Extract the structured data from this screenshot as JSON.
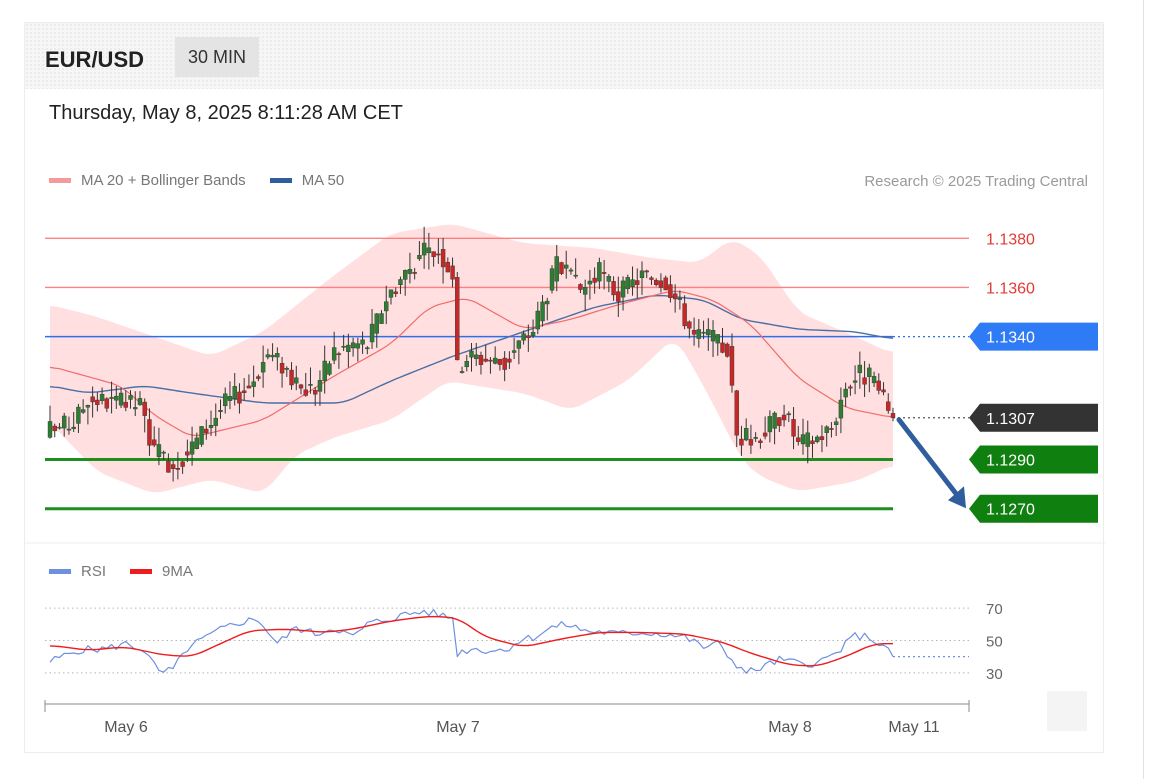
{
  "header": {
    "symbol": "EUR/USD",
    "interval": "30 MIN",
    "timestamp": "Thursday, May 8, 2025 8:11:28 AM CET"
  },
  "legend": {
    "ma20_label": "MA 20 + Bollinger Bands",
    "ma50_label": "MA 50",
    "copyright": "Research © 2025 Trading Central",
    "rsi_label": "RSI",
    "rsi_ma_label": "9MA"
  },
  "colors": {
    "bull": "#2e7d32",
    "bear": "#c62828",
    "ma20": "#f26b6b",
    "bands": "#ffd9d9",
    "ma50": "#4a6fa5",
    "resistance": "#ff8080",
    "pivot": "#2f6fec",
    "support": "#1e8e1e",
    "last": "#333333",
    "arrow": "#2f5d9e",
    "rsi": "#6f8fe0",
    "rsi_ma": "#ee1c1c"
  },
  "chart_data": [
    {
      "type": "candlestick",
      "title": "EUR/USD 30 MIN",
      "x_labels": [
        "May 6",
        "May 7",
        "May 8",
        "May 11"
      ],
      "ylim": [
        1.1265,
        1.1385
      ],
      "levels": [
        {
          "price": "1.1380",
          "value": 1.138,
          "role": "resistance"
        },
        {
          "price": "1.1360",
          "value": 1.136,
          "role": "resistance"
        },
        {
          "price": "1.1340",
          "value": 1.134,
          "role": "pivot"
        },
        {
          "price": "1.1307",
          "value": 1.1307,
          "role": "last"
        },
        {
          "price": "1.1290",
          "value": 1.129,
          "role": "support"
        },
        {
          "price": "1.1270",
          "value": 1.127,
          "role": "support"
        }
      ],
      "close_anchors": [
        [
          0,
          1.1302
        ],
        [
          5,
          1.1305
        ],
        [
          8,
          1.1315
        ],
        [
          14,
          1.1313
        ],
        [
          19,
          1.1312
        ],
        [
          22,
          1.1293
        ],
        [
          26,
          1.1288
        ],
        [
          29,
          1.1293
        ],
        [
          33,
          1.1303
        ],
        [
          37,
          1.1313
        ],
        [
          42,
          1.132
        ],
        [
          46,
          1.1333
        ],
        [
          50,
          1.1327
        ],
        [
          52,
          1.1319
        ],
        [
          56,
          1.1319
        ],
        [
          60,
          1.1334
        ],
        [
          64,
          1.1337
        ],
        [
          67,
          1.1337
        ],
        [
          71,
          1.1356
        ],
        [
          75,
          1.1366
        ],
        [
          79,
          1.1374
        ],
        [
          82,
          1.1375
        ],
        [
          85,
          1.1366
        ],
        [
          86,
          1.1327
        ],
        [
          88,
          1.1332
        ],
        [
          92,
          1.1331
        ],
        [
          96,
          1.1329
        ],
        [
          99,
          1.1337
        ],
        [
          102,
          1.1343
        ],
        [
          107,
          1.1369
        ],
        [
          112,
          1.1359
        ],
        [
          116,
          1.1366
        ],
        [
          120,
          1.1357
        ],
        [
          125,
          1.1365
        ],
        [
          130,
          1.1363
        ],
        [
          133,
          1.1352
        ],
        [
          136,
          1.134
        ],
        [
          139,
          1.134
        ],
        [
          141,
          1.1337
        ],
        [
          143,
          1.1335
        ],
        [
          145,
          1.13
        ],
        [
          148,
          1.1298
        ],
        [
          151,
          1.1302
        ],
        [
          155,
          1.131
        ],
        [
          158,
          1.1296
        ],
        [
          162,
          1.1299
        ],
        [
          165,
          1.1303
        ],
        [
          168,
          1.132
        ],
        [
          171,
          1.1325
        ],
        [
          174,
          1.1322
        ],
        [
          176,
          1.1313
        ],
        [
          178,
          1.1307
        ]
      ],
      "ma20_anchors": [
        [
          0,
          1.1328
        ],
        [
          15,
          1.132
        ],
        [
          22,
          1.1308
        ],
        [
          30,
          1.1299
        ],
        [
          45,
          1.1306
        ],
        [
          60,
          1.1324
        ],
        [
          72,
          1.1337
        ],
        [
          80,
          1.1352
        ],
        [
          88,
          1.1356
        ],
        [
          100,
          1.1343
        ],
        [
          110,
          1.1347
        ],
        [
          120,
          1.1353
        ],
        [
          132,
          1.1359
        ],
        [
          140,
          1.1355
        ],
        [
          148,
          1.1345
        ],
        [
          158,
          1.1323
        ],
        [
          168,
          1.1311
        ],
        [
          178,
          1.1307
        ]
      ],
      "upper_band_anchors": [
        [
          0,
          1.1353
        ],
        [
          10,
          1.1348
        ],
        [
          22,
          1.134
        ],
        [
          34,
          1.1332
        ],
        [
          45,
          1.1342
        ],
        [
          60,
          1.1365
        ],
        [
          72,
          1.1382
        ],
        [
          85,
          1.1386
        ],
        [
          100,
          1.1378
        ],
        [
          115,
          1.1376
        ],
        [
          127,
          1.1372
        ],
        [
          137,
          1.137
        ],
        [
          144,
          1.138
        ],
        [
          150,
          1.1373
        ],
        [
          158,
          1.135
        ],
        [
          170,
          1.134
        ],
        [
          178,
          1.1333
        ]
      ],
      "lower_band_anchors": [
        [
          0,
          1.1305
        ],
        [
          10,
          1.1285
        ],
        [
          22,
          1.1276
        ],
        [
          34,
          1.1282
        ],
        [
          45,
          1.1276
        ],
        [
          52,
          1.1292
        ],
        [
          60,
          1.1299
        ],
        [
          72,
          1.1306
        ],
        [
          84,
          1.1322
        ],
        [
          90,
          1.132
        ],
        [
          100,
          1.1317
        ],
        [
          110,
          1.131
        ],
        [
          122,
          1.1322
        ],
        [
          132,
          1.134
        ],
        [
          138,
          1.132
        ],
        [
          146,
          1.129
        ],
        [
          150,
          1.1283
        ],
        [
          158,
          1.1277
        ],
        [
          170,
          1.1281
        ],
        [
          178,
          1.1288
        ]
      ],
      "ma50_anchors": [
        [
          0,
          1.132
        ],
        [
          8,
          1.1317
        ],
        [
          20,
          1.132
        ],
        [
          30,
          1.1317
        ],
        [
          45,
          1.1313
        ],
        [
          62,
          1.1313
        ],
        [
          72,
          1.1322
        ],
        [
          85,
          1.1332
        ],
        [
          100,
          1.1342
        ],
        [
          115,
          1.1352
        ],
        [
          128,
          1.1357
        ],
        [
          138,
          1.1355
        ],
        [
          146,
          1.1347
        ],
        [
          158,
          1.1343
        ],
        [
          170,
          1.1342
        ],
        [
          178,
          1.1339
        ]
      ],
      "arrow": {
        "from": 1.1307,
        "to": 1.1271
      }
    },
    {
      "type": "line",
      "title": "RSI",
      "ylim": [
        20,
        75
      ],
      "gridlines": [
        "70",
        "50",
        "30"
      ],
      "series": [
        {
          "name": "RSI",
          "anchors": [
            [
              0,
              37
            ],
            [
              6,
              44
            ],
            [
              12,
              45
            ],
            [
              16,
              48
            ],
            [
              20,
              44
            ],
            [
              23,
              30
            ],
            [
              26,
              32
            ],
            [
              29,
              45
            ],
            [
              33,
              52
            ],
            [
              37,
              58
            ],
            [
              41,
              62
            ],
            [
              44,
              63
            ],
            [
              48,
              48
            ],
            [
              52,
              58
            ],
            [
              56,
              54
            ],
            [
              60,
              58
            ],
            [
              64,
              52
            ],
            [
              67,
              60
            ],
            [
              71,
              63
            ],
            [
              75,
              66
            ],
            [
              79,
              68
            ],
            [
              82,
              66
            ],
            [
              85,
              64
            ],
            [
              86,
              42
            ],
            [
              89,
              45
            ],
            [
              92,
              44
            ],
            [
              96,
              44
            ],
            [
              99,
              50
            ],
            [
              102,
              52
            ],
            [
              106,
              58
            ],
            [
              109,
              60
            ],
            [
              113,
              56
            ],
            [
              117,
              55
            ],
            [
              120,
              54
            ],
            [
              125,
              55
            ],
            [
              130,
              54
            ],
            [
              134,
              52
            ],
            [
              138,
              46
            ],
            [
              141,
              48
            ],
            [
              144,
              38
            ],
            [
              147,
              30
            ],
            [
              150,
              33
            ],
            [
              154,
              38
            ],
            [
              158,
              36
            ],
            [
              162,
              36
            ],
            [
              166,
              42
            ],
            [
              170,
              53
            ],
            [
              173,
              52
            ],
            [
              176,
              46
            ],
            [
              178,
              40
            ]
          ]
        },
        {
          "name": "9MA",
          "anchors": [
            [
              0,
              47
            ],
            [
              8,
              44
            ],
            [
              16,
              46
            ],
            [
              24,
              41
            ],
            [
              30,
              40
            ],
            [
              36,
              48
            ],
            [
              42,
              56
            ],
            [
              50,
              57
            ],
            [
              58,
              55
            ],
            [
              64,
              57
            ],
            [
              72,
              62
            ],
            [
              80,
              65
            ],
            [
              86,
              64
            ],
            [
              92,
              52
            ],
            [
              100,
              46
            ],
            [
              108,
              51
            ],
            [
              116,
              55
            ],
            [
              124,
              55
            ],
            [
              134,
              54
            ],
            [
              142,
              49
            ],
            [
              148,
              42
            ],
            [
              156,
              35
            ],
            [
              162,
              34
            ],
            [
              168,
              40
            ],
            [
              174,
              48
            ],
            [
              178,
              48
            ]
          ]
        }
      ]
    }
  ]
}
